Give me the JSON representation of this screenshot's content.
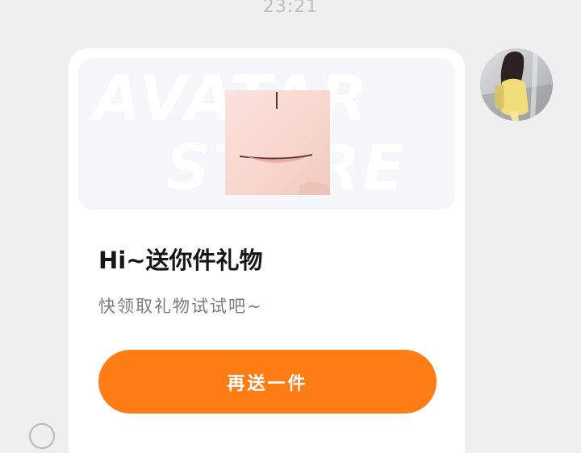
{
  "message": {
    "timestamp": "23:21"
  },
  "card": {
    "watermark_top": "AVATAR",
    "watermark_bottom": "STORE",
    "title": "Hi~送你件礼物",
    "subtitle": "快领取礼物试试吧~",
    "action_label": "再送一件",
    "accent_color": "#ff7d14"
  },
  "icons": {
    "avatar": "user-avatar-photo",
    "select": "select-circle-icon",
    "gift": "lips-item-thumbnail"
  }
}
